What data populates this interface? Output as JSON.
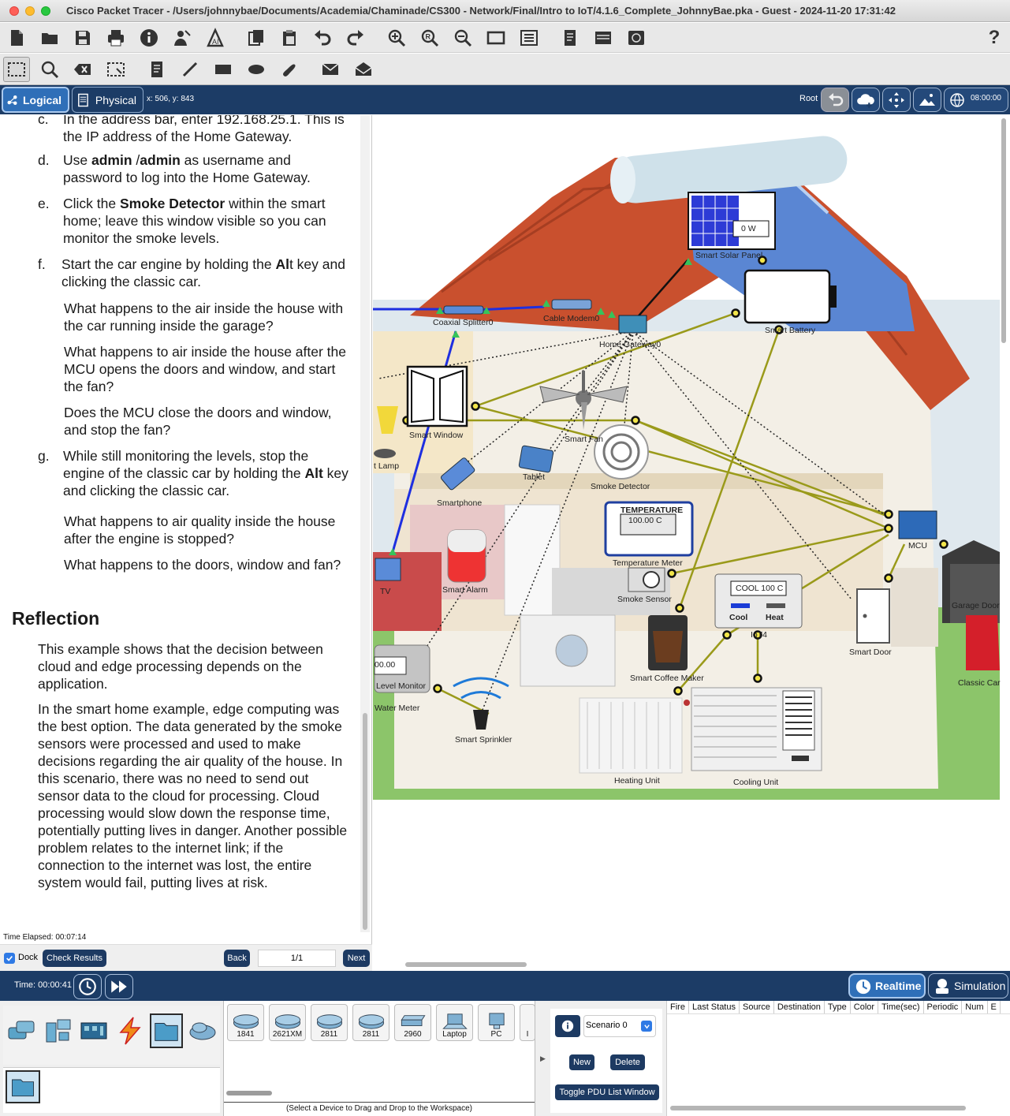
{
  "window": {
    "title": "Cisco Packet Tracer - /Users/johnnybae/Documents/Academia/Chaminade/CS300 - Network/Final/Intro to IoT/4.1.6_Complete_JohnnyBae.pka - Guest - 2024-11-20 17:31:42"
  },
  "toolbar": {
    "help_label": "?"
  },
  "modebar": {
    "logical_label": "Logical",
    "physical_label": "Physical",
    "coords": "x: 506, y: 843",
    "root_label": "Root",
    "clock": "08:00:00"
  },
  "instructions": {
    "c_label": "c.",
    "c_text": "In the address bar, enter 192.168.25.1. This is the IP address of the Home Gateway.",
    "d_label": "d.",
    "d_pre": "Use ",
    "d_bold": "admin",
    "d_mid": " /",
    "d_bold2": "admin",
    "d_post": " as username and password to log into the Home Gateway.",
    "e_label": "e.",
    "e_pre": "Click the ",
    "e_bold": "Smoke Detector",
    "e_post": " within the smart home; leave this window visible so you can monitor the smoke levels.",
    "f_label": "f.",
    "f_pre": "Start the car engine by holding the ",
    "f_bold": "Al",
    "f_post": "t key and clicking the classic car.",
    "f_q1": "What happens to the air inside the house with the car running inside the garage?",
    "f_q2": "What happens to air inside the house after the MCU opens the doors and window, and start the fan?",
    "f_q3": "Does the MCU close the doors and window, and stop the fan?",
    "g_label": "g.",
    "g_pre": "While still monitoring the levels, stop the engine of the classic car by holding the ",
    "g_bold": "Alt",
    "g_post": " key and clicking the classic car.",
    "g_q1": "What happens to air quality inside the house after the engine is stopped?",
    "g_q2": "What happens to the doors, window and fan?",
    "reflection_heading": "Reflection",
    "reflection_p1": "This example shows that the decision between cloud and edge processing depends on the application.",
    "reflection_p2": "In the smart home example, edge computing was the best option. The data generated by the smoke sensors were processed and used to make decisions regarding the air quality of the house. In this scenario, there was no need to send out sensor data to the cloud for processing. Cloud processing would slow down the response time, potentially putting lives in danger. Another possible problem relates to the internet link; if the connection to the internet was lost, the entire system would fail, putting lives at risk."
  },
  "leftfooter": {
    "time_elapsed": "Time Elapsed: 00:07:14",
    "dock_label": "Dock",
    "check_results": "Check Results",
    "back": "Back",
    "page": "1/1",
    "next": "Next"
  },
  "workspace": {
    "solar_reading": "0 W",
    "temp_header": "TEMPERATURE",
    "temp_value": "100.00 C",
    "water_value": "00.00",
    "water_sublabel": "Level Monitor",
    "cool_reading": "COOL  100 C",
    "cool_btn": "Cool",
    "heat_btn": "Heat",
    "labels": {
      "coaxial_splitter": "Coaxial Splitter0",
      "cable_modem": "Cable Modem0",
      "home_gateway": "Home Gateway0",
      "solar_panel": "Smart Solar Panel",
      "battery": "Smart Battery",
      "smart_window": "Smart Window",
      "smart_fan": "Smart Fan",
      "lamp": "t Lamp",
      "tablet": "Tablet",
      "smoke_detector": "Smoke Detector",
      "smartphone": "Smartphone",
      "temp_meter": "Temperature Meter",
      "mcu": "MCU",
      "garage_door": "Garage Door",
      "tv": "TV",
      "smart_alarm": "Smart Alarm",
      "smoke_sensor": "Smoke Sensor",
      "iot4": "IoT4",
      "smart_door": "Smart Door",
      "coffee_maker": "Smart Coffee Maker",
      "classic_car": "Classic Car",
      "water_meter": "Water Meter",
      "sprinkler": "Smart Sprinkler",
      "heating_unit": "Heating Unit",
      "cooling_unit": "Cooling Unit"
    }
  },
  "statusbar": {
    "time": "Time: 00:00:41",
    "realtime": "Realtime",
    "simulation": "Simulation"
  },
  "devices": [
    {
      "label": "1841"
    },
    {
      "label": "2621XM"
    },
    {
      "label": "2811"
    },
    {
      "label": "2811"
    },
    {
      "label": "2960"
    },
    {
      "label": "Laptop"
    },
    {
      "label": "PC"
    },
    {
      "label": "I"
    }
  ],
  "device_hint": "(Select a Device to Drag and Drop to the Workspace)",
  "scenario": {
    "selected": "Scenario 0",
    "new": "New",
    "delete": "Delete",
    "toggle": "Toggle PDU List Window"
  },
  "pdu_columns": [
    "Fire",
    "Last Status",
    "Source",
    "Destination",
    "Type",
    "Color",
    "Time(sec)",
    "Periodic",
    "Num",
    "E"
  ],
  "colors": {
    "navy": "#1c3c66",
    "realtime_blue": "#2f6fb8",
    "link_olive": "#9a9a1a",
    "link_blue": "#1e2fe0"
  }
}
